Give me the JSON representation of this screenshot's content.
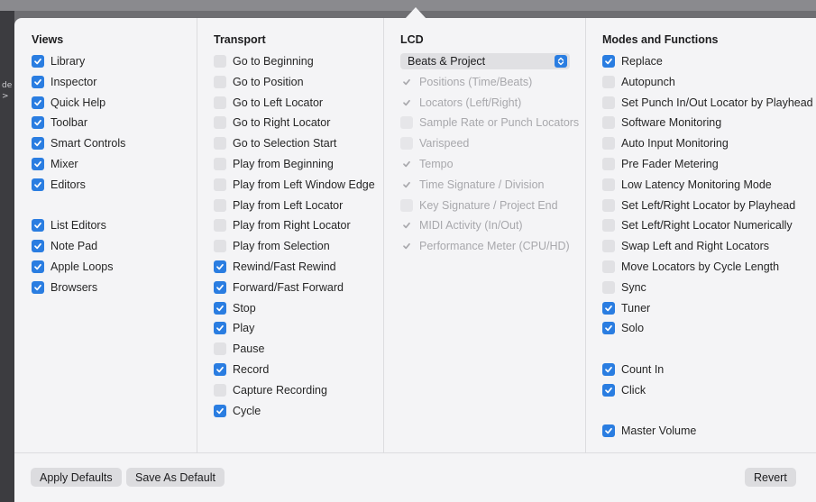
{
  "background_fragments": [
    "de",
    ">"
  ],
  "views": {
    "title": "Views",
    "items": [
      {
        "label": "Library",
        "checked": true
      },
      {
        "label": "Inspector",
        "checked": true
      },
      {
        "label": "Quick Help",
        "checked": true
      },
      {
        "label": "Toolbar",
        "checked": true
      },
      {
        "label": "Smart Controls",
        "checked": true
      },
      {
        "label": "Mixer",
        "checked": true
      },
      {
        "label": "Editors",
        "checked": true
      },
      {
        "label": "List Editors",
        "checked": true
      },
      {
        "label": "Note Pad",
        "checked": true
      },
      {
        "label": "Apple Loops",
        "checked": true
      },
      {
        "label": "Browsers",
        "checked": true
      }
    ]
  },
  "transport": {
    "title": "Transport",
    "items": [
      {
        "label": "Go to Beginning",
        "checked": false
      },
      {
        "label": "Go to Position",
        "checked": false
      },
      {
        "label": "Go to Left Locator",
        "checked": false
      },
      {
        "label": "Go to Right Locator",
        "checked": false
      },
      {
        "label": "Go to Selection Start",
        "checked": false
      },
      {
        "label": "Play from Beginning",
        "checked": false
      },
      {
        "label": "Play from Left Window Edge",
        "checked": false
      },
      {
        "label": "Play from Left Locator",
        "checked": false
      },
      {
        "label": "Play from Right Locator",
        "checked": false
      },
      {
        "label": "Play from Selection",
        "checked": false
      },
      {
        "label": "Rewind/Fast Rewind",
        "checked": true
      },
      {
        "label": "Forward/Fast Forward",
        "checked": true
      },
      {
        "label": "Stop",
        "checked": true
      },
      {
        "label": "Play",
        "checked": true
      },
      {
        "label": "Pause",
        "checked": false
      },
      {
        "label": "Record",
        "checked": true
      },
      {
        "label": "Capture Recording",
        "checked": false
      },
      {
        "label": "Cycle",
        "checked": true
      }
    ]
  },
  "lcd": {
    "title": "LCD",
    "mode_selected": "Beats & Project",
    "items": [
      {
        "label": "Positions (Time/Beats)",
        "checked": true
      },
      {
        "label": "Locators (Left/Right)",
        "checked": true
      },
      {
        "label": "Sample Rate or Punch Locators",
        "checked": false
      },
      {
        "label": "Varispeed",
        "checked": false
      },
      {
        "label": "Tempo",
        "checked": true
      },
      {
        "label": "Time Signature / Division",
        "checked": true
      },
      {
        "label": "Key Signature / Project End",
        "checked": false
      },
      {
        "label": "MIDI Activity (In/Out)",
        "checked": true
      },
      {
        "label": "Performance Meter (CPU/HD)",
        "checked": true
      }
    ]
  },
  "modes": {
    "title": "Modes and Functions",
    "items": [
      {
        "label": "Replace",
        "checked": true
      },
      {
        "label": "Autopunch",
        "checked": false
      },
      {
        "label": "Set Punch In/Out Locator by Playhead",
        "checked": false
      },
      {
        "label": "Software Monitoring",
        "checked": false
      },
      {
        "label": "Auto Input Monitoring",
        "checked": false
      },
      {
        "label": "Pre Fader Metering",
        "checked": false
      },
      {
        "label": "Low Latency Monitoring Mode",
        "checked": false
      },
      {
        "label": "Set Left/Right Locator by Playhead",
        "checked": false
      },
      {
        "label": "Set Left/Right Locator Numerically",
        "checked": false
      },
      {
        "label": "Swap Left and Right Locators",
        "checked": false
      },
      {
        "label": "Move Locators by Cycle Length",
        "checked": false
      },
      {
        "label": "Sync",
        "checked": false
      },
      {
        "label": "Tuner",
        "checked": true
      },
      {
        "label": "Solo",
        "checked": true
      },
      {
        "label": "Count In",
        "checked": true
      },
      {
        "label": "Click",
        "checked": true
      },
      {
        "label": "Master Volume",
        "checked": true
      }
    ]
  },
  "footer": {
    "apply_defaults": "Apply Defaults",
    "save_as_default": "Save As Default",
    "revert": "Revert"
  },
  "colors": {
    "accent": "#2a7de1",
    "panel_bg": "#f4f4f6"
  }
}
